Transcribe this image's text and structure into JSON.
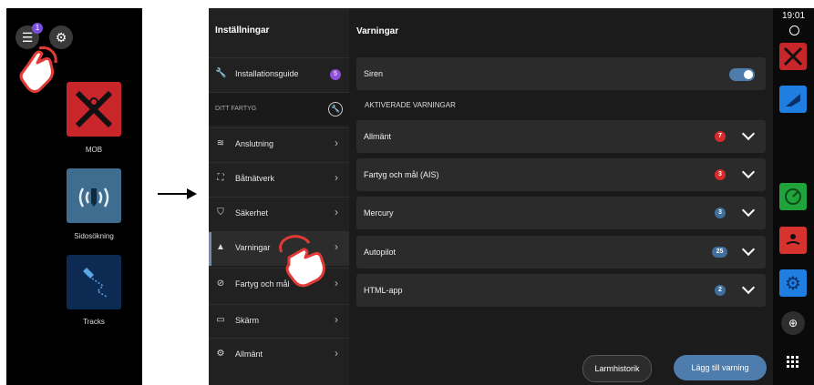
{
  "home": {
    "badge": "1",
    "apps": [
      {
        "label": "MOB"
      },
      {
        "label": "Sidosökning"
      },
      {
        "label": "Tracks"
      }
    ]
  },
  "nav": {
    "title": "Inställningar",
    "installation": {
      "label": "Installationsguide",
      "badge": "5"
    },
    "section": "DITT FARTYG",
    "items": [
      {
        "label": "Anslutning"
      },
      {
        "label": "Båtnätverk"
      },
      {
        "label": "Säkerhet"
      },
      {
        "label": "Varningar"
      },
      {
        "label": "Fartyg och mål"
      },
      {
        "label": "Skärm"
      },
      {
        "label": "Allmänt"
      }
    ]
  },
  "main": {
    "title": "Varningar",
    "siren": {
      "label": "Siren",
      "enabled": true
    },
    "section": "AKTIVERADE VARNINGAR",
    "rows": [
      {
        "label": "Allmänt",
        "count": "7",
        "color": "#d92b2b"
      },
      {
        "label": "Fartyg och mål (AIS)",
        "count": "3",
        "color": "#d92b2b"
      },
      {
        "label": "Mercury",
        "count": "3",
        "color": "#3f6f9e"
      },
      {
        "label": "Autopilot",
        "count": "25",
        "color": "#3f6f9e"
      },
      {
        "label": "HTML-app",
        "count": "2",
        "color": "#3f6f9e"
      }
    ],
    "history_button": "Larmhistorik",
    "add_button": "Lägg till varning"
  },
  "rail": {
    "time": "19:01"
  },
  "colors": {
    "accent": "#4e7cad",
    "badge_red": "#d92b2b",
    "badge_blue": "#3f6f9e"
  }
}
